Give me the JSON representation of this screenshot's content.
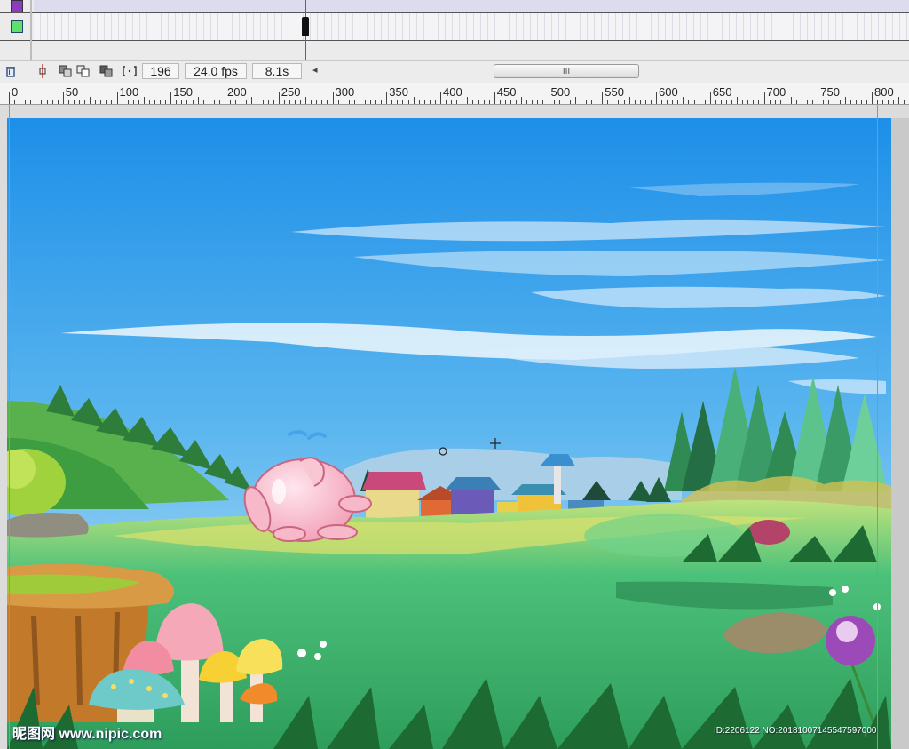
{
  "timeline": {
    "layers": [
      {
        "swatch_color": "#8b3dbd",
        "swatch_icon": "square-purple-icon"
      },
      {
        "swatch_color": "#5ee06e",
        "swatch_icon": "square-green-icon"
      }
    ],
    "current_frame_marker": "playhead"
  },
  "toolbar": {
    "trash_icon": "trash-icon",
    "onion_icon": "center-frame-icon",
    "onion_skin_icon": "onion-skin-icon",
    "onion_outline_icon": "onion-skin-outline-icon",
    "edit_multiple_icon": "edit-multiple-frames-icon",
    "modify_markers_icon": "modify-markers-icon",
    "current_frame": "196",
    "frame_rate": "24.0 fps",
    "elapsed_time": "8.1s",
    "scroll_left_glyph": "◂",
    "scroll_thumb_glyph": "III"
  },
  "ruler": {
    "labels": [
      "0",
      "50",
      "100",
      "150",
      "200",
      "250",
      "300",
      "350",
      "400",
      "450",
      "500",
      "550",
      "600",
      "650",
      "700",
      "750",
      "800"
    ]
  },
  "stage": {
    "sky_top_color": "#1d8fe8",
    "sky_bottom_color": "#cfe9f7",
    "meadow_color": "#3dbb6e",
    "pig_color": "#f7b9c9",
    "watermark_text": "昵图网 www.nipic.com",
    "watermark_id": "ID:2206122 NO:20181007145547597000"
  }
}
